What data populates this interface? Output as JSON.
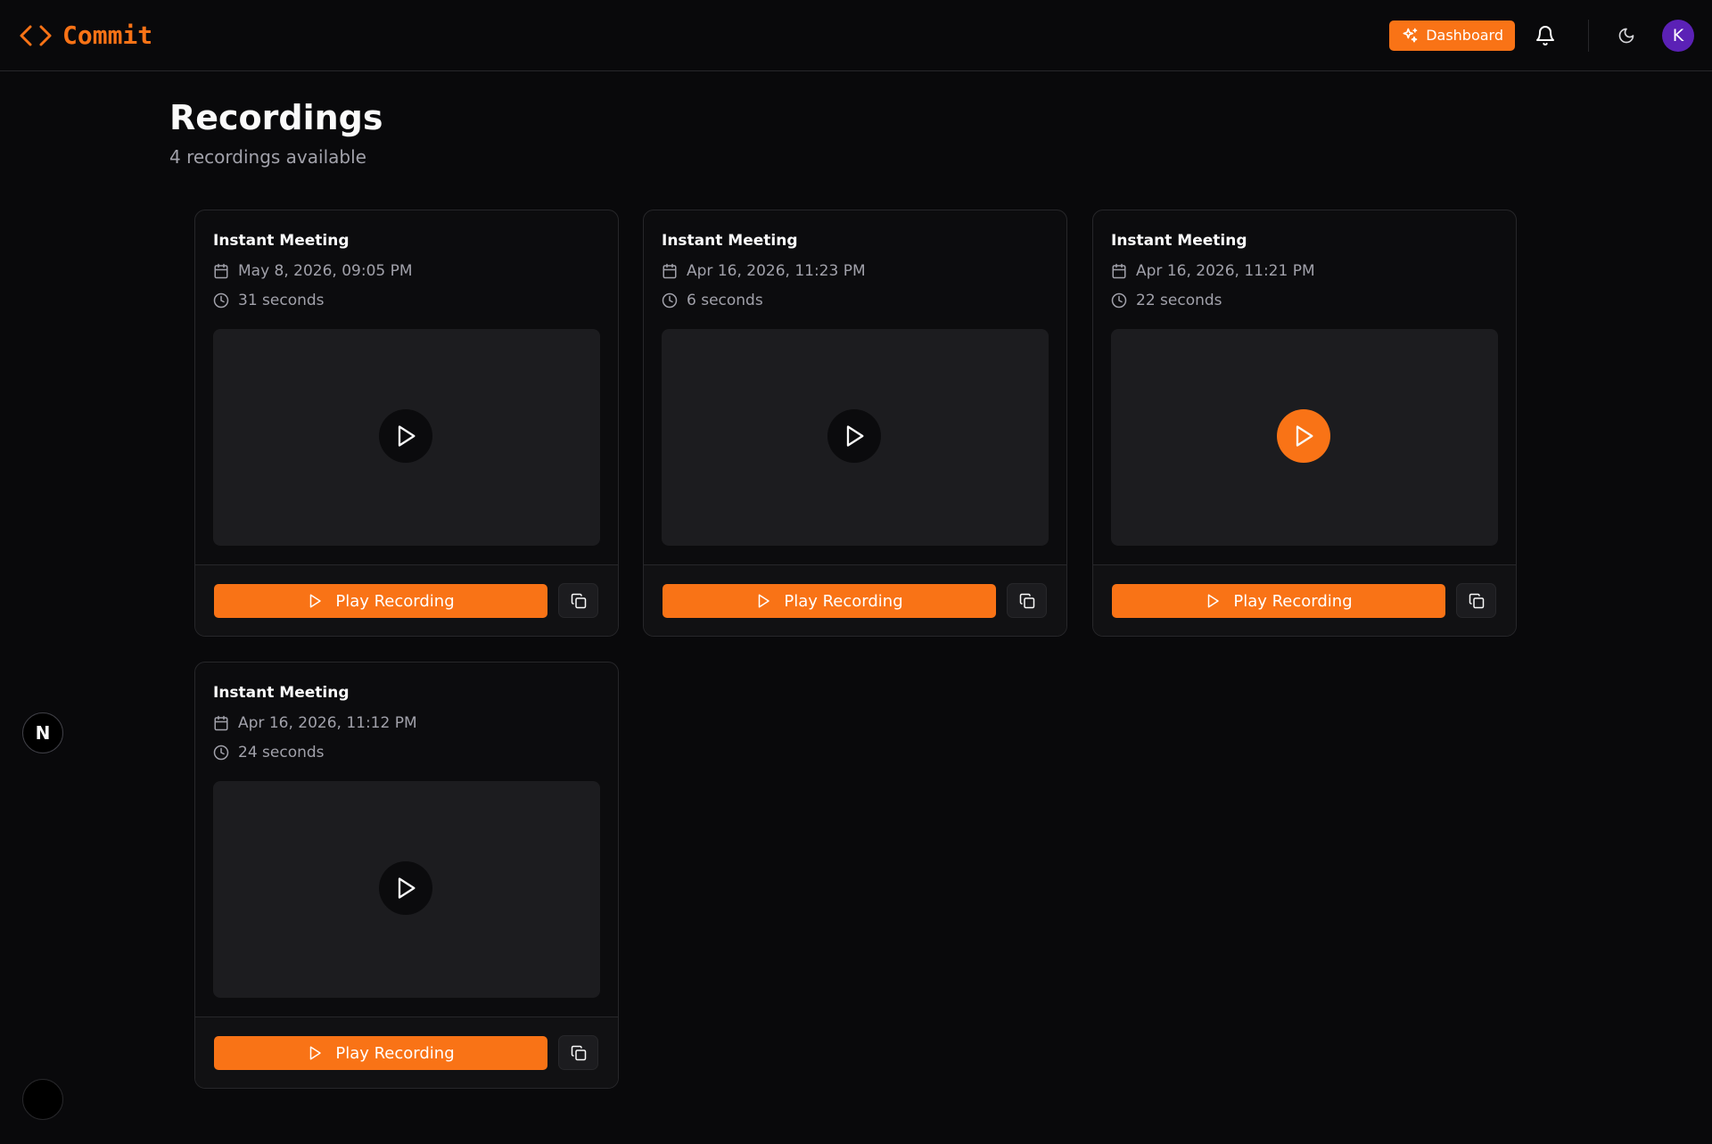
{
  "header": {
    "brand_name": "Commit",
    "dashboard_label": "Dashboard",
    "avatar_initial": "K",
    "accent_color": "#f97316",
    "avatar_color": "#5b21b6"
  },
  "page": {
    "title": "Recordings",
    "subtitle": "4 recordings available"
  },
  "floating": {
    "badge_letter": "N"
  },
  "recordings": [
    {
      "title": "Instant Meeting",
      "date": "May 8, 2026, 09:05 PM",
      "duration": "31 seconds",
      "play_label": "Play Recording",
      "highlighted": false
    },
    {
      "title": "Instant Meeting",
      "date": "Apr 16, 2026, 11:23 PM",
      "duration": "6 seconds",
      "play_label": "Play Recording",
      "highlighted": false
    },
    {
      "title": "Instant Meeting",
      "date": "Apr 16, 2026, 11:21 PM",
      "duration": "22 seconds",
      "play_label": "Play Recording",
      "highlighted": true
    },
    {
      "title": "Instant Meeting",
      "date": "Apr 16, 2026, 11:12 PM",
      "duration": "24 seconds",
      "play_label": "Play Recording",
      "highlighted": false
    }
  ]
}
